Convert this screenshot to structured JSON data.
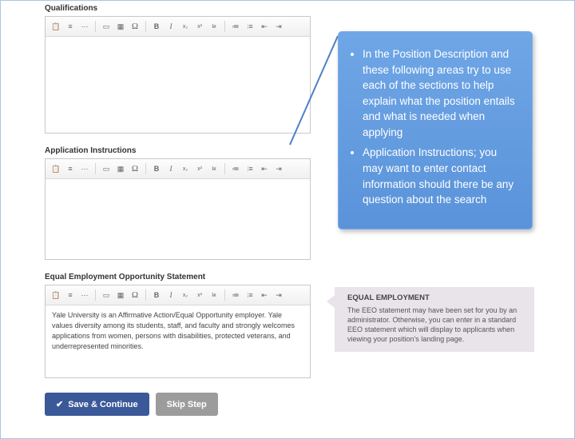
{
  "sections": {
    "qualifications_label": "Qualifications",
    "application_instructions_label": "Application Instructions",
    "eeo_label": "Equal Employment Opportunity Statement",
    "eeo_text": "Yale University is an Affirmative Action/Equal Opportunity employer. Yale values diversity among its students, staff, and faculty and strongly welcomes applications from women, persons with disabilities, protected veterans, and underrepresented minorities."
  },
  "toolbar": {
    "paste": "📋",
    "source": "≡",
    "more": "⋯",
    "image": "▭",
    "table": "▦",
    "omega": "Ω",
    "bold": "B",
    "italic": "I",
    "sub": "x₂",
    "sup": "x²",
    "clear": "I̵x",
    "bullets": "≔",
    "numbers": "⦙≡",
    "outdent": "⇤",
    "indent": "⇥"
  },
  "buttons": {
    "save_continue": "Save & Continue",
    "skip_step": "Skip Step"
  },
  "callout": {
    "item1": "In the Position Description and these following areas try to use each of the sections to help explain what the position entails and what is needed when applying",
    "item2": "Application Instructions; you may want to enter contact information should there be any question about the search"
  },
  "sidebox": {
    "title": "EQUAL EMPLOYMENT",
    "body": "The EEO statement may have been set for you by an administrator. Otherwise, you can enter in a standard EEO statement which will display to applicants when viewing your position's landing page."
  }
}
